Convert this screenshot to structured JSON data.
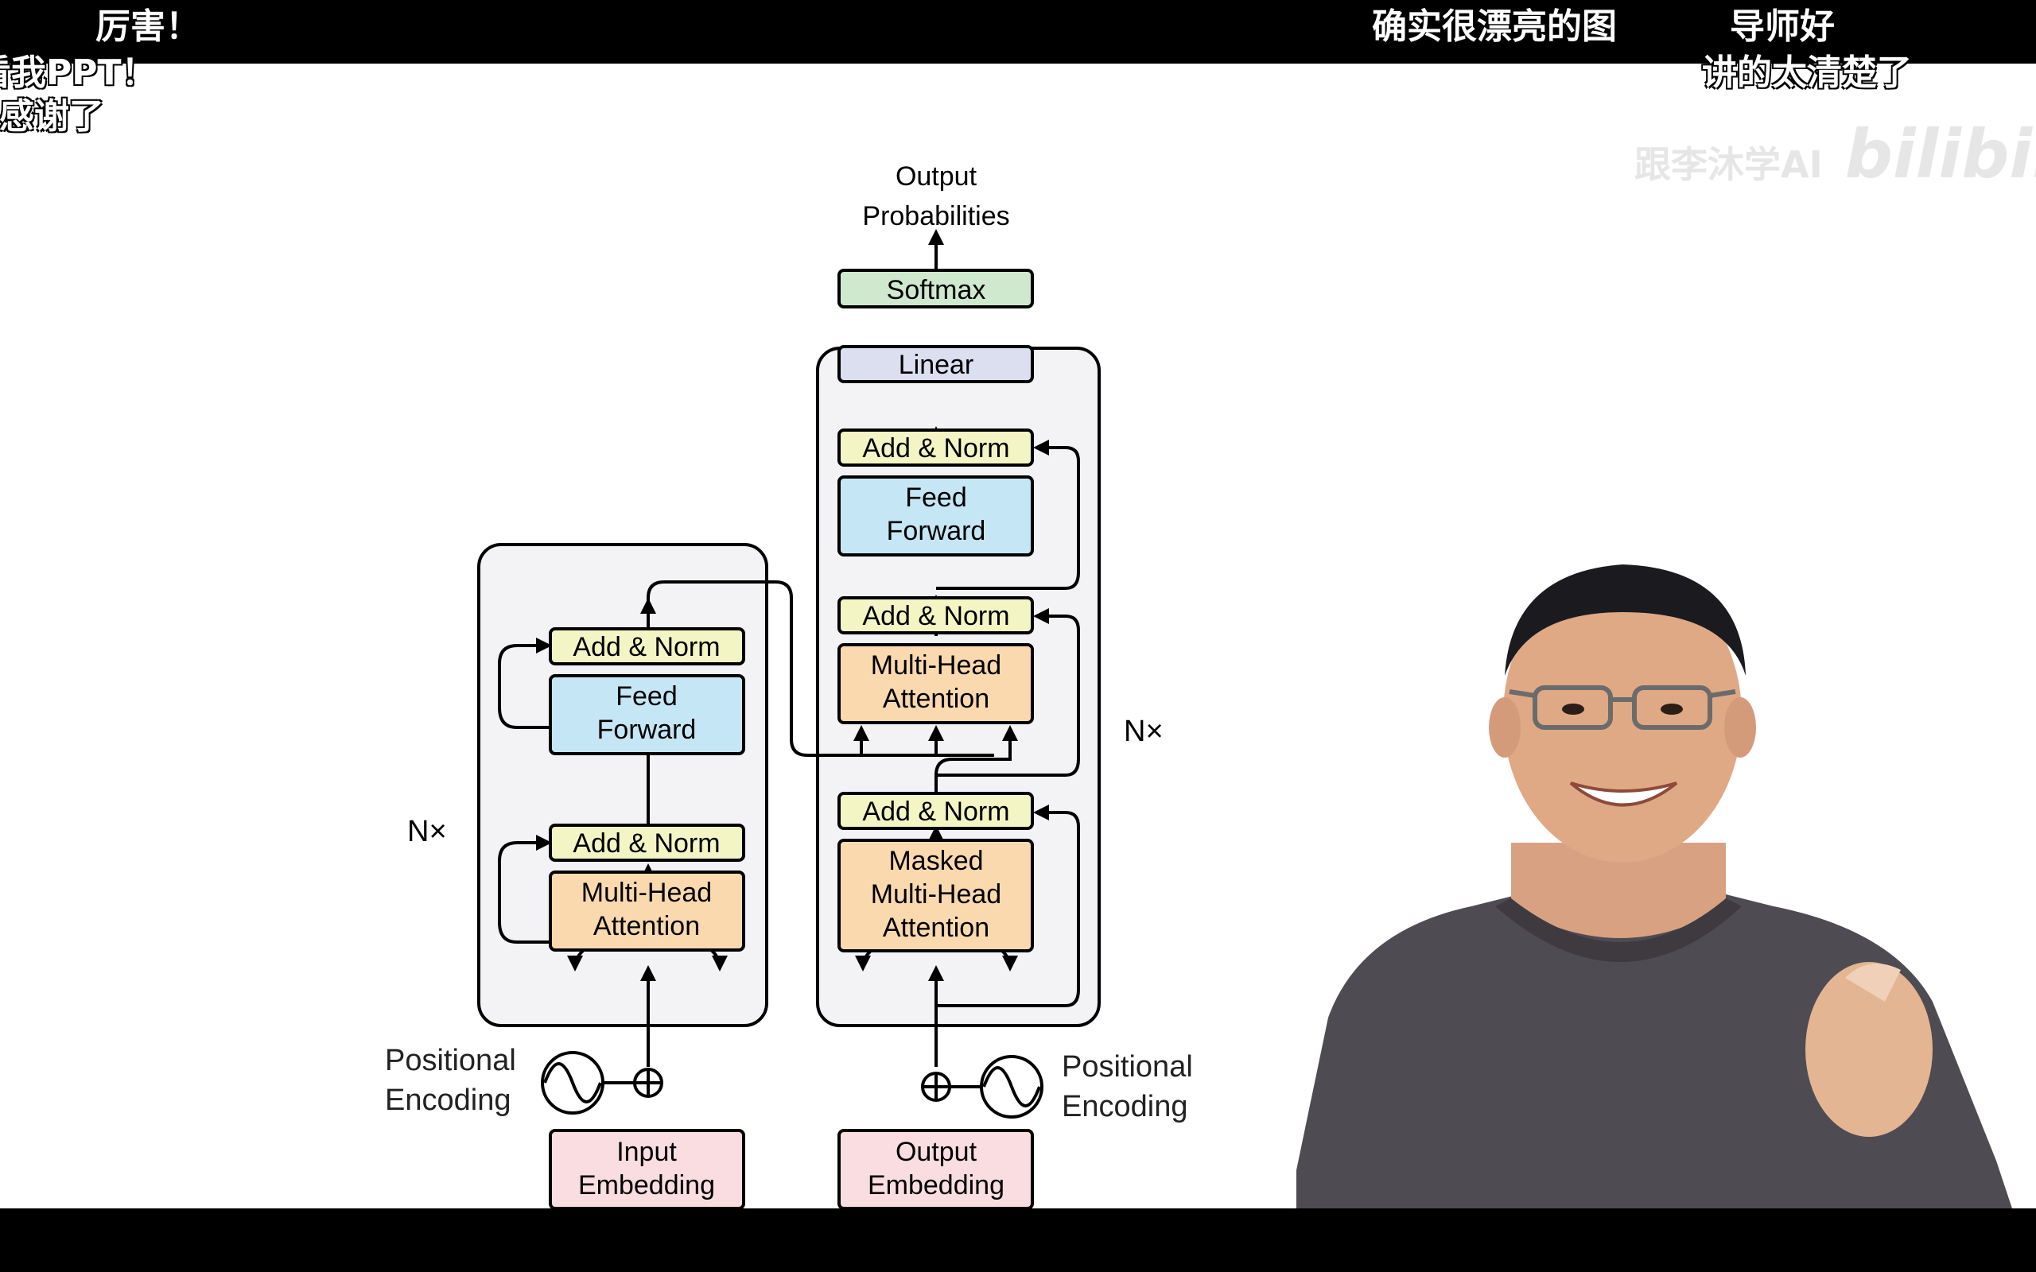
{
  "danmaku": {
    "d1": "厉害！",
    "d2": "确实很漂亮的图",
    "d3": "导师好",
    "d4": "看我PPT！",
    "d5": "讲的太清楚了",
    "d6": "大感谢了"
  },
  "watermark": {
    "text": "跟李沐学AI",
    "logo": "bilibili"
  },
  "diagram": {
    "output_probabilities": [
      "Output",
      "Probabilities"
    ],
    "softmax": "Softmax",
    "linear": "Linear",
    "add_norm": "Add & Norm",
    "feed_forward": [
      "Feed",
      "Forward"
    ],
    "multi_head_attention": [
      "Multi-Head",
      "Attention"
    ],
    "masked_multi_head_attention": [
      "Masked",
      "Multi-Head",
      "Attention"
    ],
    "nx": "N×",
    "positional_encoding": [
      "Positional",
      "Encoding"
    ],
    "input_embedding": [
      "Input",
      "Embedding"
    ],
    "output_embedding": [
      "Output",
      "Embedding"
    ]
  },
  "colors": {
    "add_norm": "#f3f6c4",
    "feed_forward": "#c5e6f4",
    "attention": "#fad9af",
    "embedding": "#f9dde0",
    "softmax": "#cfe9cf",
    "linear": "#dcdff0",
    "stack_bg": "#f3f2f4"
  }
}
